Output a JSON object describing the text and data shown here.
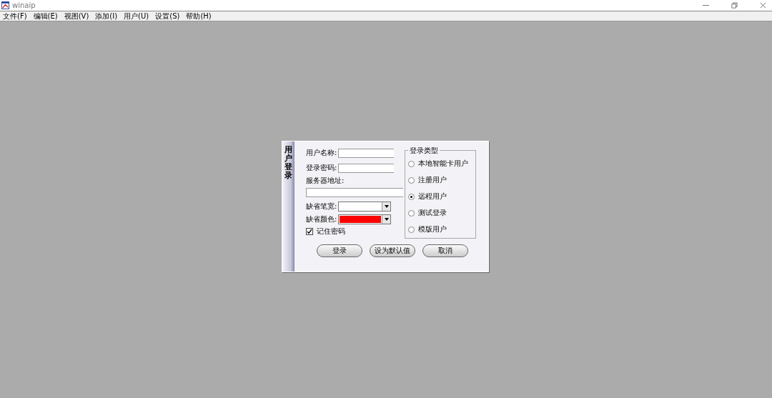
{
  "window": {
    "title": "winaip"
  },
  "menu": [
    "文件(F)",
    "编辑(E)",
    "视图(V)",
    "添加(I)",
    "用户(U)",
    "设置(S)",
    "帮助(H)"
  ],
  "dialog": {
    "side_title": "用户登录",
    "fields": [
      {
        "label": "用户名称:",
        "kind": "inline"
      },
      {
        "label": "登录密码:",
        "kind": "inline"
      },
      {
        "label": "服务器地址:",
        "kind": "stacked"
      }
    ],
    "dropdowns": [
      {
        "label": "缺省笔宽:",
        "color": "#ffffff"
      },
      {
        "label": "缺省颜色:",
        "color": "#ff0000"
      }
    ],
    "remember": {
      "label": "记住密码",
      "checked": true
    },
    "login_type": {
      "title": "登录类型",
      "options": [
        {
          "label": "本地智能卡用户",
          "selected": false
        },
        {
          "label": "注册用户",
          "selected": false
        },
        {
          "label": "远程用户",
          "selected": true
        },
        {
          "label": "测试登录",
          "selected": false
        },
        {
          "label": "模版用户",
          "selected": false
        }
      ]
    },
    "buttons": [
      "登录",
      "设为默认值",
      "取消"
    ]
  }
}
